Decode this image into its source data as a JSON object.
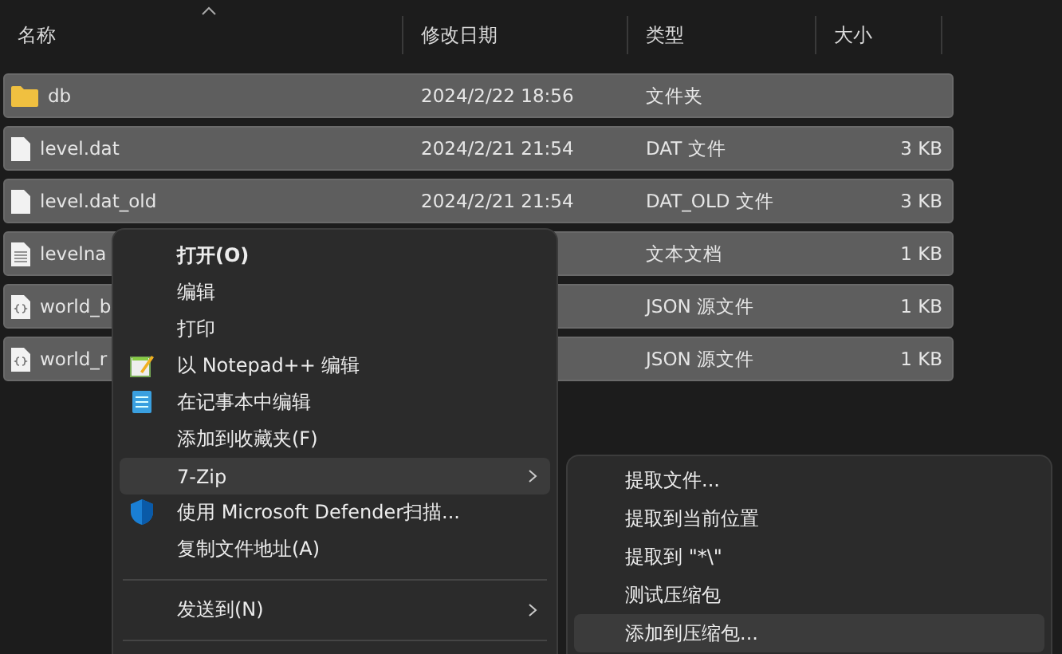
{
  "columns": [
    "名称",
    "修改日期",
    "类型",
    "大小"
  ],
  "rows": [
    {
      "kind": "folder",
      "name": "db",
      "date": "2024/2/22 18:56",
      "type": "文件夹",
      "size": "",
      "selected": true
    },
    {
      "kind": "file",
      "name": "level.dat",
      "date": "2024/2/21 21:54",
      "type": "DAT 文件",
      "size": "3 KB",
      "selected": true
    },
    {
      "kind": "file",
      "name": "level.dat_old",
      "date": "2024/2/21 21:54",
      "type": "DAT_OLD 文件",
      "size": "3 KB",
      "selected": true
    },
    {
      "kind": "text",
      "name": "levelna",
      "date": "",
      "type": "文本文档",
      "size": "1 KB",
      "selected": true
    },
    {
      "kind": "json",
      "name": "world_b",
      "date": "",
      "type": "JSON 源文件",
      "size": "1 KB",
      "selected": true
    },
    {
      "kind": "json",
      "name": "world_r",
      "date": "",
      "type": "JSON 源文件",
      "size": "1 KB",
      "selected": true
    }
  ],
  "menu": [
    {
      "kind": "item",
      "label": "打开(O)",
      "default": true,
      "hovered": false
    },
    {
      "kind": "item",
      "label": "编辑",
      "hovered": false
    },
    {
      "kind": "item",
      "label": "打印",
      "hovered": false
    },
    {
      "kind": "notepadpp",
      "label": "以 Notepad++ 编辑",
      "hovered": false
    },
    {
      "kind": "notepad",
      "label": "在记事本中编辑",
      "hovered": false
    },
    {
      "kind": "item",
      "label": "添加到收藏夹(F)",
      "hovered": false
    },
    {
      "kind": "item",
      "label": "7-Zip",
      "submenu": true,
      "hovered": true
    },
    {
      "kind": "shield",
      "label": "使用 Microsoft Defender扫描...",
      "hovered": false
    },
    {
      "kind": "item",
      "label": "复制文件地址(A)",
      "hovered": false
    },
    {
      "kind": "separator"
    },
    {
      "kind": "item",
      "label": "发送到(N)",
      "submenu": true,
      "hovered": false
    },
    {
      "kind": "separator"
    }
  ],
  "submenu": [
    {
      "label": "提取文件...",
      "hovered": false
    },
    {
      "label": "提取到当前位置",
      "hovered": false
    },
    {
      "label": "提取到 \"*\\\"",
      "hovered": false
    },
    {
      "label": "测试压缩包",
      "hovered": false
    },
    {
      "label": "添加到压缩包...",
      "hovered": true
    }
  ]
}
